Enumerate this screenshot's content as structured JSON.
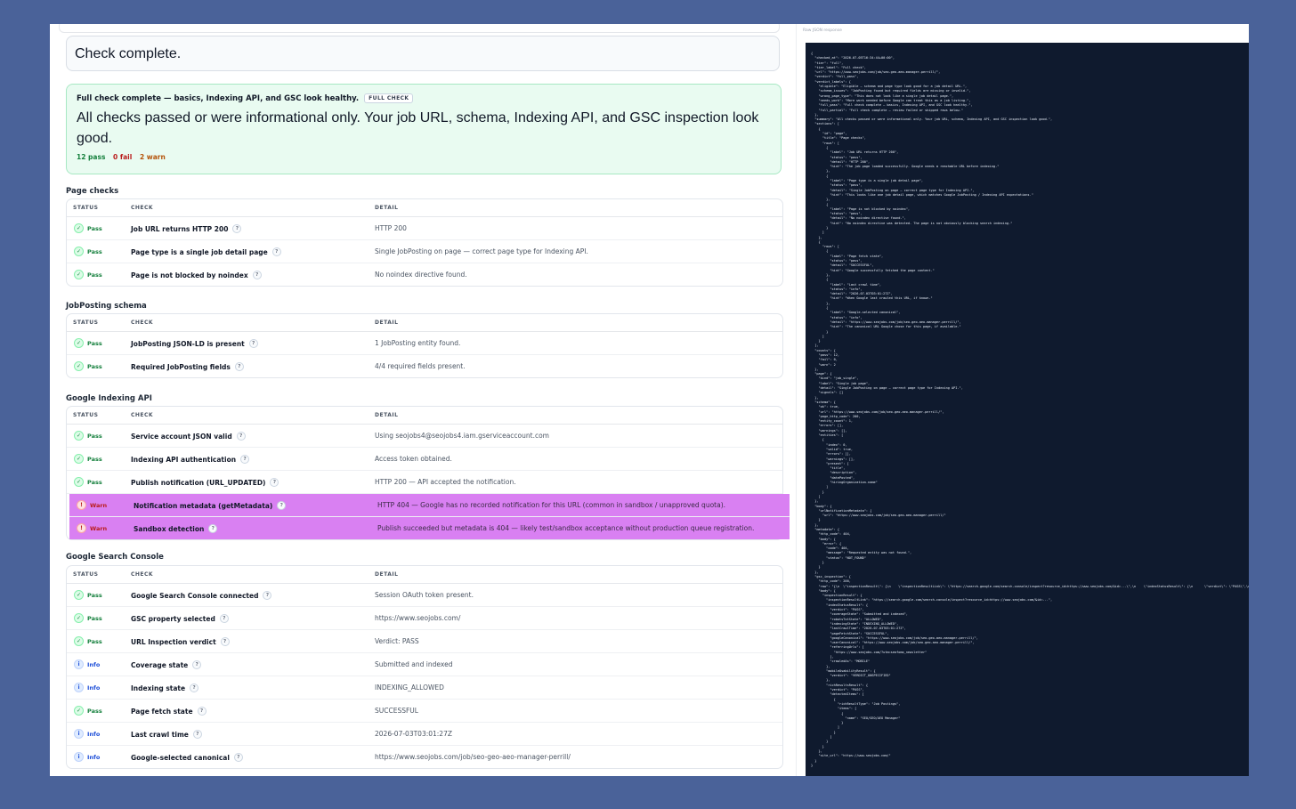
{
  "banner": {
    "text": "Check complete."
  },
  "summary": {
    "title": "Full check complete — basics, Indexing API, and GSC look healthy.",
    "badge": "FULL CHECK",
    "body": "All checks passed or were informational only. Your job URL, schema, Indexing API, and GSC inspection look good.",
    "pass": "12 pass",
    "fail": "0 fail",
    "warn": "2 warn"
  },
  "columns": {
    "status": "STATUS",
    "check": "CHECK",
    "detail": "DETAIL"
  },
  "sections": [
    {
      "title": "Page checks",
      "rows": [
        {
          "status": "pass",
          "status_label": "Pass",
          "check": "Job URL returns HTTP 200",
          "detail": "HTTP 200"
        },
        {
          "status": "pass",
          "status_label": "Pass",
          "check": "Page type is a single job detail page",
          "detail": "Single JobPosting on page — correct page type for Indexing API."
        },
        {
          "status": "pass",
          "status_label": "Pass",
          "check": "Page is not blocked by noindex",
          "detail": "No noindex directive found."
        }
      ]
    },
    {
      "title": "JobPosting schema",
      "rows": [
        {
          "status": "pass",
          "status_label": "Pass",
          "check": "JobPosting JSON-LD is present",
          "detail": "1 JobPosting entity found."
        },
        {
          "status": "pass",
          "status_label": "Pass",
          "check": "Required JobPosting fields",
          "detail": "4/4 required fields present."
        }
      ]
    },
    {
      "title": "Google Indexing API",
      "rows": [
        {
          "status": "pass",
          "status_label": "Pass",
          "check": "Service account JSON valid",
          "detail": "Using seojobs4@seojobs4.iam.gserviceaccount.com"
        },
        {
          "status": "pass",
          "status_label": "Pass",
          "check": "Indexing API authentication",
          "detail": "Access token obtained."
        },
        {
          "status": "pass",
          "status_label": "Pass",
          "check": "Publish notification (URL_UPDATED)",
          "detail": "HTTP 200 — API accepted the notification."
        },
        {
          "status": "warn",
          "status_label": "Warn",
          "check": "Notification metadata (getMetadata)",
          "detail": "HTTP 404 — Google has no recorded notification for this URL (common in sandbox / unapproved quota)."
        },
        {
          "status": "warn",
          "status_label": "Warn",
          "check": "Sandbox detection",
          "detail": "Publish succeeded but metadata is 404 — likely test/sandbox acceptance without production queue registration."
        }
      ]
    },
    {
      "title": "Google Search Console",
      "rows": [
        {
          "status": "pass",
          "status_label": "Pass",
          "check": "Google Search Console connected",
          "detail": "Session OAuth token present."
        },
        {
          "status": "pass",
          "status_label": "Pass",
          "check": "GSC property selected",
          "detail": "https://www.seojobs.com/"
        },
        {
          "status": "pass",
          "status_label": "Pass",
          "check": "URL Inspection verdict",
          "detail": "Verdict: PASS"
        },
        {
          "status": "info",
          "status_label": "Info",
          "check": "Coverage state",
          "detail": "Submitted and indexed"
        },
        {
          "status": "info",
          "status_label": "Info",
          "check": "Indexing state",
          "detail": "INDEXING_ALLOWED"
        },
        {
          "status": "pass",
          "status_label": "Pass",
          "check": "Page fetch state",
          "detail": "SUCCESSFUL"
        },
        {
          "status": "info",
          "status_label": "Info",
          "check": "Last crawl time",
          "detail": "2026-07-03T03:01:27Z"
        },
        {
          "status": "info",
          "status_label": "Info",
          "check": "Google-selected canonical",
          "detail": "https://www.seojobs.com/job/seo-geo-aeo-manager-perrill/"
        }
      ]
    }
  ],
  "right_panel": {
    "header": "Raw JSON response",
    "json": "{\n  \"checked_at\": \"2026-07-05T16:34:44+00:00\",\n  \"tier\": \"full\",\n  \"tier_label\": \"Full check\",\n  \"url\": \"https://www.seojobs.com/job/seo-geo-aeo-manager-perrill/\",\n  \"verdict\": \"full_pass\",\n  \"verdict_labels\": {\n    \"eligible\": \"Eligible — schema and page type look good for a job detail URL.\",\n    \"schema_issues\": \"JobPosting found but required fields are missing or invalid.\",\n    \"wrong_page_type\": \"This does not look like a single job detail page.\",\n    \"needs_work\": \"More work needed before Google can treat this as a job listing.\",\n    \"full_pass\": \"Full check complete — basics, Indexing API, and GSC look healthy.\",\n    \"full_partial\": \"Full check complete — review failed or skipped rows below.\"\n  },\n  \"summary\": \"All checks passed or were informational only. Your job URL, schema, Indexing API, and GSC inspection look good.\",\n  \"sections\": [\n    {\n      \"id\": \"page\",\n      \"title\": \"Page checks\",\n      \"rows\": [\n        {\n          \"label\": \"Job URL returns HTTP 200\",\n          \"status\": \"pass\",\n          \"detail\": \"HTTP 200\",\n          \"hint\": \"The job page loaded successfully. Google needs a reachable URL before indexing.\"\n        },\n        {\n          \"label\": \"Page type is a single job detail page\",\n          \"status\": \"pass\",\n          \"detail\": \"Single JobPosting on page — correct page type for Indexing API.\",\n          \"hint\": \"This looks like one job detail page, which matches Google JobPosting / Indexing API expectations.\"\n        },\n        {\n          \"label\": \"Page is not blocked by noindex\",\n          \"status\": \"pass\",\n          \"detail\": \"No noindex directive found.\",\n          \"hint\": \"No noindex directive was detected. The page is not obviously blocking search indexing.\"\n        }\n      ]\n    },\n    {\n      \"rows\": [\n        {\n          \"label\": \"Page fetch state\",\n          \"status\": \"pass\",\n          \"detail\": \"SUCCESSFUL\",\n          \"hint\": \"Google successfully fetched the page content.\"\n        },\n        {\n          \"label\": \"Last crawl time\",\n          \"status\": \"info\",\n          \"detail\": \"2026-07-03T03:01:27Z\",\n          \"hint\": \"When Google last crawled this URL, if known.\"\n        },\n        {\n          \"label\": \"Google-selected canonical\",\n          \"status\": \"info\",\n          \"detail\": \"https://www.seojobs.com/job/seo-geo-aeo-manager-perrill/\",\n          \"hint\": \"The canonical URL Google chose for this page, if available.\"\n        }\n      ]\n    }\n  ],\n  \"counts\": {\n    \"pass\": 12,\n    \"fail\": 0,\n    \"warn\": 2\n  },\n  \"page\": {\n    \"kind\": \"job_single\",\n    \"label\": \"Single job page\",\n    \"detail\": \"Single JobPosting on page — correct page type for Indexing API.\",\n    \"signals\": []\n  },\n  \"schema\": {\n    \"ok\": true,\n    \"url\": \"https://www.seojobs.com/job/seo-geo-aeo-manager-perrill/\",\n    \"page_http_code\": 200,\n    \"entity_count\": 1,\n    \"errors\": [],\n    \"warnings\": [],\n    \"entities\": [\n      {\n        \"index\": 0,\n        \"valid\": true,\n        \"errors\": [],\n        \"warnings\": [],\n        \"present\": [\n          \"title\",\n          \"description\",\n          \"datePosted\",\n          \"hiringOrganization.name\"\n        ]\n      }\n    ]\n  },\n  \"body\": {\n    \"urlNotificationMetadata\": {\n      \"url\": \"https://www.seojobs.com/job/seo-geo-aeo-manager-perrill/\"\n    }\n  },\n  \"metadata\": {\n    \"http_code\": 404,\n    \"body\": {\n      \"error\": {\n        \"code\": 404,\n        \"message\": \"Requested entity was not found.\",\n        \"status\": \"NOT_FOUND\"\n      }\n    }\n  },\n  \"gsc_inspection\": {\n    \"http_code\": 200,\n    \"raw\": \"{\\n  \\\"inspectionResult\\\": {\\n    \\\"inspectionResultLink\\\": \\\"https://search.google.com/search-console/inspect?resource_id=https://www.seojobs.com/&id=...\\\",\\n    \\\"indexStatusResult\\\": {\\n      \\\"verdict\\\": \\\"PASS\\\",\\n      \\\"coverageState\\\": \\\"Submitted and indexed\\\",\\n      \\\"robotsTxtState\\\": \\\"ALLOWED\\\",\\n      \\\"indexingState\\\": \\\"INDEXING_ALLOWED\\\",\\n      \\\"lastCrawlTime\\\": \\\"2026-07-03T03:01:27Z\\\",\\n      \\\"pageFetchState\\\": \\\"SUCCESSFUL\\\",\\n      \\\"googleCanonical\\\": \\\"https://www.seojobs.com/job/seo-geo-aeo-manager-perrill/\\\",\\n      \\\"userCanonical\\\": \\\"https://www.seojobs.com/job/seo-geo-aeo-manager-perrill/\\\",\\n      \\\"crawledAs\\\": \\\"MOBILE\\\"\\n    },\\n    \\\"mobileUsabilityResult\\\": {\\n      \\\"verdict\\\": \\\"VERDICT_UNSPECIFIED\\\"\\n    },\\n    \\\"richResultsResult\\\": {\\n      \\\"verdict\\\": \\\"PASS\\\",\\n      \\\"detectedItems\\\": [\\n        {\\n          \\\"richResultType\\\": \\\"Job Postings\\\",\\n          \\\"items\\\": [\\n            {\\n              \\\"name\\\": \\\"SEO/GEO/AEO Manager\\\"\\n            }\\n          ]\\n        }\\n      ]\\n    }\\n  }\\n}\",\n    \"body\": {\n      \"inspectionResult\": {\n        \"inspectionResultLink\": \"https://search.google.com/search-console/inspect?resource_id=https://www.seojobs.com/&id=...\",\n        \"indexStatusResult\": {\n          \"verdict\": \"PASS\",\n          \"coverageState\": \"Submitted and indexed\",\n          \"robotsTxtState\": \"ALLOWED\",\n          \"indexingState\": \"INDEXING_ALLOWED\",\n          \"lastCrawlTime\": \"2026-07-03T03:01:27Z\",\n          \"pageFetchState\": \"SUCCESSFUL\",\n          \"googleCanonical\": \"https://www.seojobs.com/job/seo-geo-aeo-manager-perrill/\",\n          \"userCanonical\": \"https://www.seojobs.com/job/seo-geo-aeo-manager-perrill/\",\n          \"referringUrls\": [\n            \"https://www.seojobs.com/?utm=seofomo_newsletter\"\n          ],\n          \"crawledAs\": \"MOBILE\"\n        },\n        \"mobileUsabilityResult\": {\n          \"verdict\": \"VERDICT_UNSPECIFIED\"\n        },\n        \"richResultsResult\": {\n          \"verdict\": \"PASS\",\n          \"detectedItems\": [\n            {\n              \"richResultType\": \"Job Postings\",\n              \"items\": [\n                {\n                  \"name\": \"SEO/GEO/AEO Manager\"\n                }\n              ]\n            }\n          ]\n        }\n      }\n    },\n    \"site_url\": \"https://www.seojobs.com/\"\n  }\n}"
  }
}
